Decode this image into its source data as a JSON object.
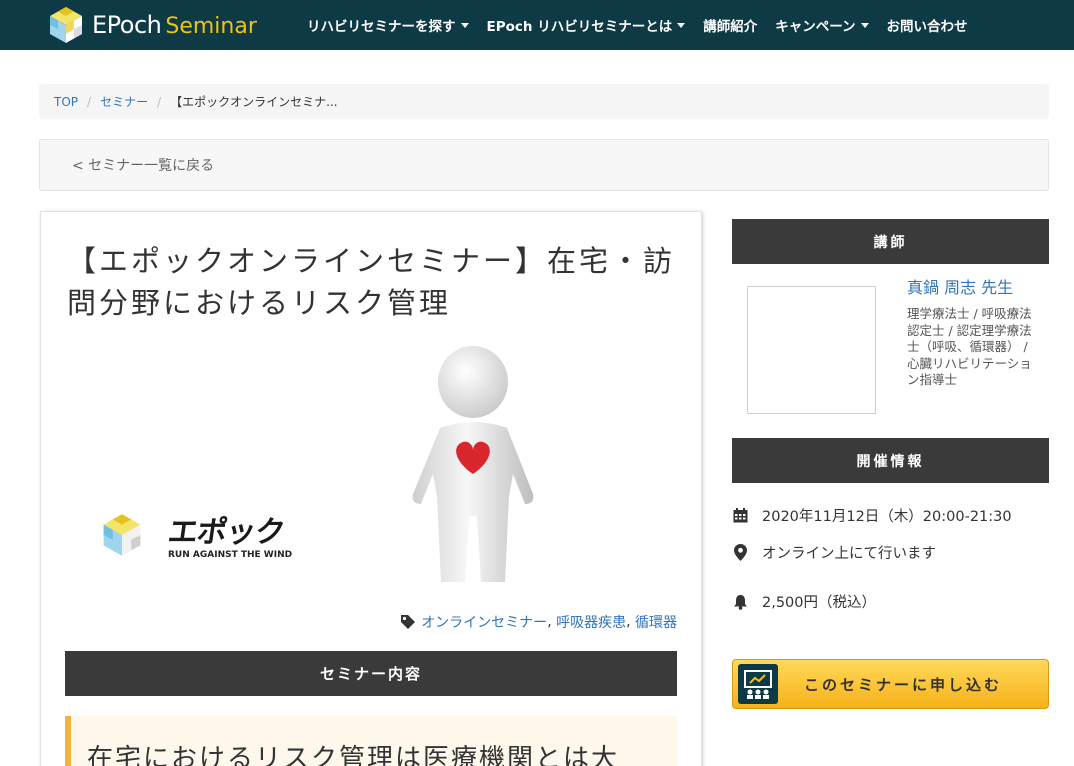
{
  "brand": {
    "name_part1": "EPoch",
    "name_part2": "Seminar"
  },
  "nav": [
    {
      "label": "リハビリセミナーを探す",
      "dropdown": true
    },
    {
      "label": "EPoch リハビリセミナーとは",
      "dropdown": true
    },
    {
      "label": "講師紹介",
      "dropdown": false
    },
    {
      "label": "キャンペーン",
      "dropdown": true
    },
    {
      "label": "お問い合わせ",
      "dropdown": false
    }
  ],
  "breadcrumb": {
    "home": "TOP",
    "section": "セミナー",
    "current": "【エポックオンラインセミナ..."
  },
  "back_link": "< セミナー一覧に戻る",
  "seminar": {
    "title": "【エポックオンラインセミナー】在宅・訪問分野におけるリスク管理",
    "hero_logo_main": "エポック",
    "hero_logo_sub": "RUN AGAINST THE WIND",
    "tags": [
      "オンラインセミナー",
      "呼吸器疾患",
      "循環器"
    ],
    "tag_separator": ",",
    "content_header": "セミナー内容",
    "intro_text": "在宅におけるリスク管理は医療機関とは大"
  },
  "sidebar": {
    "lecturer_header": "講師",
    "lecturer_name": "真鍋 周志 先生",
    "lecturer_quals": "理学療法士 / 呼吸療法認定士 / 認定理学療法士（呼吸、循環器） / 心臓リハビリテーション指導士",
    "info_header": "開催情報",
    "date": "2020年11月12日（木）20:00-21:30",
    "location": "オンライン上にて行います",
    "price": "2,500円（税込）",
    "apply_label": "このセミナーに申し込む"
  },
  "colors": {
    "navbar": "#0e3a45",
    "brand_accent": "#f3c214",
    "link": "#3174b8",
    "dark_header": "#3a3a3a",
    "apply_button": "#f6b21a",
    "intro_border": "#f2b33d"
  },
  "icons": [
    "epoch-cube-icon",
    "caret-down-icon",
    "tag-icon",
    "calendar-icon",
    "map-pin-icon",
    "bell-icon",
    "teacher-board-icon"
  ]
}
